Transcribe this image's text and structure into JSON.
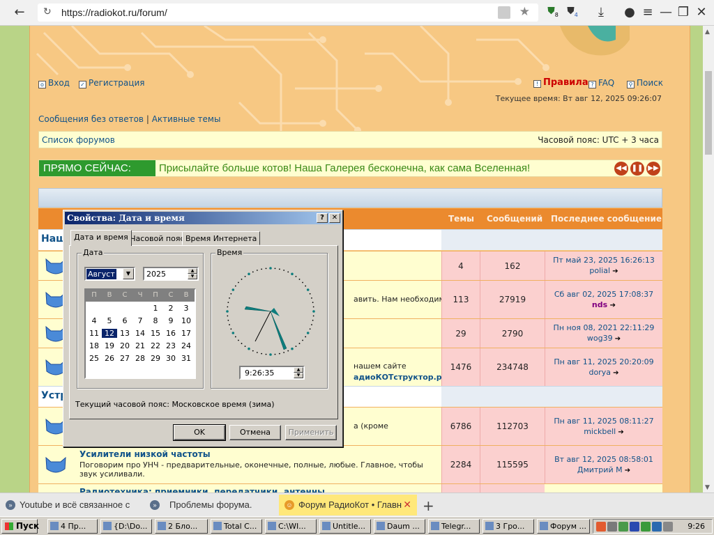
{
  "browser": {
    "url": "https://radiokot.ru/forum/",
    "ext_badge_1": "8",
    "ext_badge_2": "4"
  },
  "forum": {
    "login": "Вход",
    "register": "Регистрация",
    "rules": "Правила",
    "faq": "FAQ",
    "search": "Поиск",
    "current_time": "Текущее время: Вт авг 12, 2025 09:26:07",
    "unanswered": "Сообщения без ответов",
    "active_topics": "Активные темы",
    "separator": "|",
    "forum_list": "Список форумов",
    "timezone": "Часовой пояс: UTC + 3 часа",
    "now_badge": "ПРЯМО СЕЙЧАС:",
    "now_message": "Присылайте больше котов! Наша Галерея бесконечна, как сама Вселенная!",
    "col_topics": "Темы",
    "col_posts": "Сообщений",
    "col_last": "Последнее сообщение",
    "cat1": "Наш",
    "cat2": "Устр",
    "rows": [
      {
        "topics": "4",
        "posts": "162",
        "last_date": "Пт май 23, 2025 16:26:13",
        "last_user": "polial"
      },
      {
        "desc": "авить. Нам необходимо",
        "topics": "113",
        "posts": "27919",
        "last_date": "Сб авг 02, 2025 17:08:37",
        "last_user": "nds"
      },
      {
        "topics": "29",
        "posts": "2790",
        "last_date": "Пн ноя 08, 2021 22:11:29",
        "last_user": "wog39"
      },
      {
        "desc": "нашем сайте",
        "sub": "адиоКОТструктор.ру",
        "topics": "1476",
        "posts": "234748",
        "last_date": "Пн авг 11, 2025 20:20:09",
        "last_user": "dorya"
      },
      {
        "desc": "а (кроме",
        "topics": "6786",
        "posts": "112703",
        "last_date": "Пн авг 11, 2025 08:11:27",
        "last_user": "mickbell"
      },
      {
        "title": "Усилители низкой частоты",
        "desc": "Поговорим про УНЧ - предварительные, оконечные, полные, любые. Главное, чтобы",
        "desc2": "звук усиливали.",
        "topics": "2284",
        "posts": "115595",
        "last_date": "Вт авг 12, 2025 08:58:01",
        "last_user": "Дмитрий М"
      },
      {
        "title": "Радиотехника: приемники, передатчики, антенны"
      }
    ]
  },
  "dialog": {
    "title": "Свойства: Дата и время",
    "help": "?",
    "close": "✕",
    "tabs": [
      "Дата и время",
      "Часовой пояс",
      "Время Интернета"
    ],
    "date_label": "Дата",
    "time_label": "Время",
    "month": "Август",
    "year": "2025",
    "weekdays": [
      "П",
      "В",
      "С",
      "Ч",
      "П",
      "С",
      "В"
    ],
    "days": [
      "1",
      "2",
      "3",
      "4",
      "5",
      "6",
      "7",
      "8",
      "9",
      "10",
      "11",
      "12",
      "13",
      "14",
      "15",
      "16",
      "17",
      "18",
      "19",
      "20",
      "21",
      "22",
      "23",
      "24",
      "25",
      "26",
      "27",
      "28",
      "29",
      "30",
      "31"
    ],
    "today": "12",
    "time": "9:26:35",
    "tz_text": "Текущий часовой пояс: Московское время (зима)",
    "ok": "OK",
    "cancel": "Отмена",
    "apply": "Применить"
  },
  "tabs": [
    {
      "label": "Youtube и всё связанное с"
    },
    {
      "label": "Проблемы форума."
    },
    {
      "label": "Форум РадиоКот • Главн"
    }
  ],
  "taskbar": {
    "start": "Пуск",
    "items": [
      "4 Пр...",
      "{D:\\Do...",
      "2 Бло...",
      "Total C...",
      "C:\\WI...",
      "Untitle...",
      "Daum ...",
      "Telegr...",
      "3 Гро...",
      "Форум ..."
    ],
    "clock": "9:26"
  }
}
